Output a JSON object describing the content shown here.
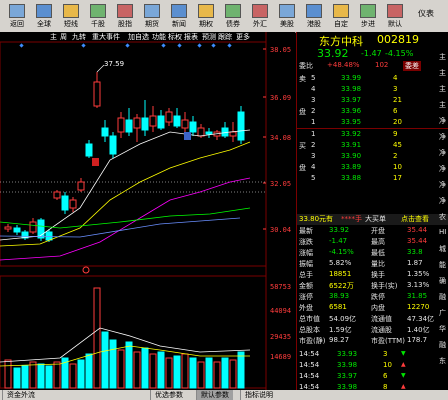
{
  "toolbar": {
    "buttons": [
      {
        "label": "返回",
        "icon": "back-icon"
      },
      {
        "label": "全球",
        "icon": "globe-icon"
      },
      {
        "label": "短线",
        "icon": "lightning-icon"
      },
      {
        "label": "千股",
        "icon": "grid-icon"
      },
      {
        "label": "股指",
        "icon": "index-icon"
      },
      {
        "label": "期货",
        "icon": "futures-icon"
      },
      {
        "label": "新闻",
        "icon": "news-icon"
      },
      {
        "label": "期权",
        "icon": "options-icon"
      },
      {
        "label": "债券",
        "icon": "bond-icon"
      },
      {
        "label": "外汇",
        "icon": "forex-icon"
      },
      {
        "label": "美股",
        "icon": "us-stock-icon"
      },
      {
        "label": "港股",
        "icon": "hk-stock-icon"
      },
      {
        "label": "自定",
        "icon": "custom-icon"
      },
      {
        "label": "步进",
        "icon": "step-icon"
      },
      {
        "label": "默认",
        "icon": "default-icon"
      }
    ],
    "right_label": "仪表"
  },
  "chart_tabs": [
    "主",
    "周",
    "九转",
    "重大事件",
    "加自选",
    "功能",
    "标权",
    "报表",
    "预测",
    "跟踪",
    "更多"
  ],
  "price_axis": [
    "38.05",
    "36.09",
    "34.08",
    "32.05",
    "30.04"
  ],
  "volume_axis": [
    "58753",
    "44094",
    "29435",
    "14689"
  ],
  "high_marker": "37.59",
  "low_marker": "30.77",
  "status_tabs": [
    "资金外流",
    "优选参数",
    "默认参数",
    "指标说明"
  ],
  "stock": {
    "name": "东方中科",
    "code": "002819",
    "price": "33.92",
    "change": "-1.47",
    "pct": "-4.15%"
  },
  "order_book": {
    "ratio_label": "委比",
    "ratio_value": "+48.48%",
    "ratio_count": "102",
    "ratio_tag": "委差",
    "sell": [
      {
        "level": "5",
        "price": "33.99",
        "vol": "4"
      },
      {
        "level": "4",
        "price": "33.98",
        "vol": "3"
      },
      {
        "level": "3",
        "price": "33.97",
        "vol": "21"
      },
      {
        "level": "2",
        "price": "33.96",
        "vol": "6"
      },
      {
        "level": "1",
        "price": "33.95",
        "vol": "20"
      }
    ],
    "buy": [
      {
        "level": "1",
        "price": "33.92",
        "vol": "9"
      },
      {
        "level": "2",
        "price": "33.91",
        "vol": "45"
      },
      {
        "level": "3",
        "price": "33.90",
        "vol": "2"
      },
      {
        "level": "4",
        "price": "33.89",
        "vol": "10"
      },
      {
        "level": "5",
        "price": "33.88",
        "vol": "17"
      }
    ]
  },
  "ticker_bar": {
    "left": "33.80元有",
    "mid": "****手",
    "buy": "大买单",
    "right": "点击查看"
  },
  "stats": [
    {
      "k1": "最新",
      "v1": "33.92",
      "k2": "开盘",
      "v2": "35.44"
    },
    {
      "k1": "涨跌",
      "v1": "-1.47",
      "k2": "最高",
      "v2": "35.44"
    },
    {
      "k1": "涨幅",
      "v1": "-4.15%",
      "k2": "最低",
      "v2": "33.8"
    },
    {
      "k1": "振幅",
      "v1": "5.82%",
      "k2": "量比",
      "v2": "1.87"
    },
    {
      "k1": "总手",
      "v1": "18851",
      "k2": "换手",
      "v2": "1.35%"
    },
    {
      "k1": "金额",
      "v1": "6522万",
      "k2": "换手(实)",
      "v2": "3.13%"
    },
    {
      "k1": "涨停",
      "v1": "38.93",
      "k2": "跌停",
      "v2": "31.85"
    },
    {
      "k1": "外盘",
      "v1": "6581",
      "k2": "内盘",
      "v2": "12270"
    },
    {
      "k1": "总市值",
      "v1": "54.09亿",
      "k2": "流通值",
      "v2": "47.34亿"
    },
    {
      "k1": "总股本",
      "v1": "1.59亿",
      "k2": "流通股",
      "v2": "1.40亿"
    },
    {
      "k1": "市盈(静)",
      "v1": "98.27",
      "k2": "市盈(TTM)",
      "v2": "178.7"
    }
  ],
  "ticks": [
    {
      "time": "14:54",
      "price": "33.93",
      "vol": "3",
      "dir": "down"
    },
    {
      "time": "14:54",
      "price": "33.98",
      "vol": "10",
      "dir": "up"
    },
    {
      "time": "14:54",
      "price": "33.97",
      "vol": "6",
      "dir": "down"
    },
    {
      "time": "14:54",
      "price": "33.98",
      "vol": "8",
      "dir": "up"
    },
    {
      "time": "14:55",
      "price": "33.99",
      "vol": "26",
      "dir": "up"
    },
    {
      "time": "14:55",
      "price": "33.98",
      "vol": "4",
      "dir": "down"
    },
    {
      "time": "14:55",
      "price": "33.99",
      "vol": "18",
      "dir": "up"
    },
    {
      "time": "14:55",
      "price": "33.98",
      "vol": "34",
      "dir": "down"
    },
    {
      "time": "14:55",
      "price": "33.92",
      "vol": "20",
      "dir": "down"
    }
  ],
  "side_labels": [
    "主",
    "主",
    "主",
    "主",
    "净",
    "净",
    "净",
    "净",
    "净",
    "净",
    "农",
    "HI",
    "城",
    "能",
    "确",
    "融",
    "广",
    "华",
    "融",
    "东"
  ],
  "colors": {
    "up": "#ff3c3c",
    "down": "#00e600",
    "bg": "#000000",
    "accent_yellow": "#ffff00"
  }
}
